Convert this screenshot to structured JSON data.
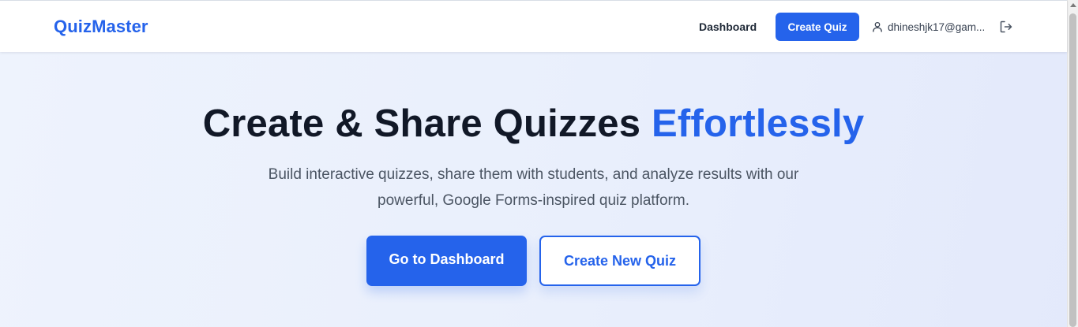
{
  "header": {
    "brand": "QuizMaster",
    "nav_dashboard": "Dashboard",
    "nav_create_quiz": "Create Quiz",
    "user_email": "dhineshjk17@gam...",
    "user_icon": "user-icon",
    "logout_icon": "logout-icon"
  },
  "hero": {
    "title_main": "Create & Share Quizzes",
    "title_accent": "Effortlessly",
    "subtitle_line1": "Build interactive quizzes, share them with students, and analyze results with our",
    "subtitle_line2": "powerful, Google Forms-inspired quiz platform.",
    "primary_button": "Go to Dashboard",
    "secondary_button": "Create New Quiz"
  },
  "colors": {
    "accent": "#2563eb",
    "heading": "#111827",
    "body_text": "#4b5563",
    "background": "#eaf0fc"
  }
}
